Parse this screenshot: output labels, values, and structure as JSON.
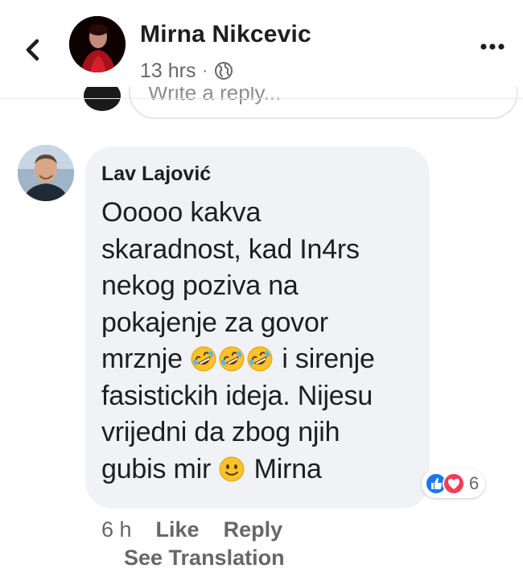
{
  "header": {
    "back_icon": "chevron-left-icon",
    "name": "Mirna Nikcevic",
    "time": "13 hrs",
    "separator": "·",
    "privacy_icon": "globe-icon",
    "more_icon": "more-horizontal-icon"
  },
  "reply_box": {
    "placeholder": "Write a reply..."
  },
  "comment": {
    "author": "Lav Lajović",
    "lines": [
      "Ooooo kakva",
      "skaradnost, kad In4rs",
      "nekog poziva na",
      "pokajenje za govor",
      "mrznje",
      "i sirenje",
      "fasistickih ideja. Nijesu",
      "vrijedni da zbog njih",
      "gubis mir",
      "Mirna"
    ],
    "emojis": {
      "laughing": "rolling-on-floor-laughing-emoji",
      "smile": "slightly-smiling-face-emoji"
    },
    "reactions": {
      "icons": [
        "like-reaction-icon",
        "love-reaction-icon"
      ],
      "count": "6"
    },
    "time": "6 h",
    "like_label": "Like",
    "reply_label": "Reply",
    "see_translation": "See Translation"
  },
  "colors": {
    "bubble": "#f0f2f5",
    "secondary_text": "#65676b",
    "like_blue": "#1877f2",
    "love_red": "#f33e58"
  }
}
